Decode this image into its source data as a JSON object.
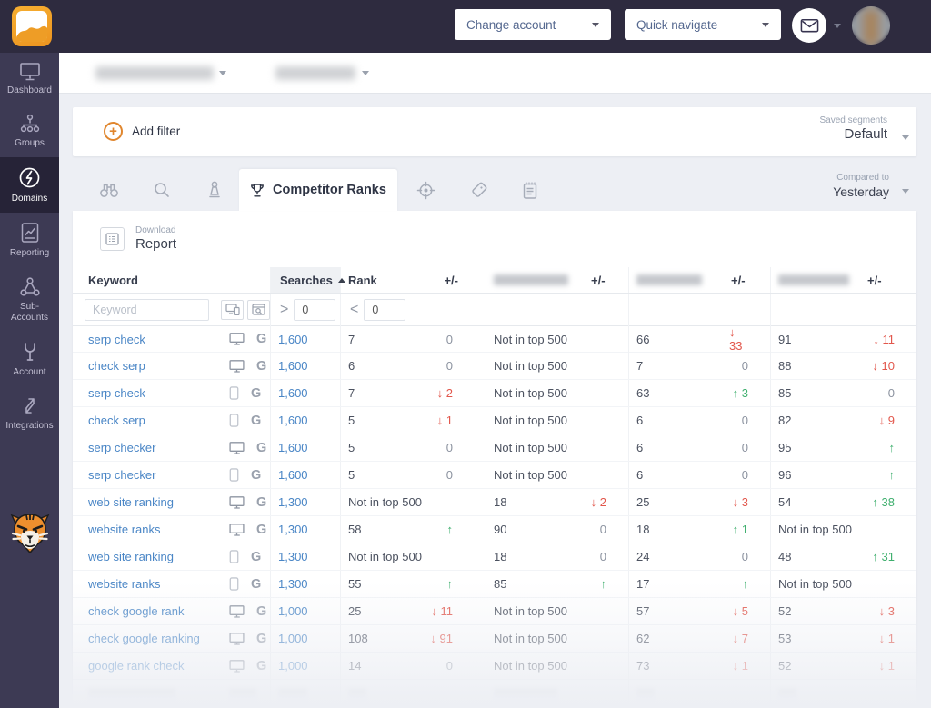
{
  "topbar": {
    "change_account": "Change account",
    "quick_navigate": "Quick navigate"
  },
  "sidebar": {
    "items": [
      {
        "label": "Dashboard",
        "icon": "dashboard-monitor-icon",
        "active": false
      },
      {
        "label": "Groups",
        "icon": "groups-hierarchy-icon",
        "active": false
      },
      {
        "label": "Domains",
        "icon": "domains-icon",
        "active": true
      },
      {
        "label": "Reporting",
        "icon": "reporting-chart-icon",
        "active": false
      },
      {
        "label": "Sub-Accounts",
        "icon": "sub-accounts-share-icon",
        "active": false
      },
      {
        "label": "Account",
        "icon": "account-wrench-icon",
        "active": false
      },
      {
        "label": "Integrations",
        "icon": "integrations-arrows-icon",
        "active": false
      }
    ]
  },
  "filter_bar": {
    "add_filter": "Add filter",
    "saved_segments_label": "Saved segments",
    "saved_segments_value": "Default"
  },
  "tab_bar": {
    "left_icons": [
      "binoculars-icon",
      "search-icon",
      "pawn-icon"
    ],
    "active_tab": "Competitor Ranks",
    "right_icons": [
      "target-icon",
      "tag-icon",
      "clipboard-icon"
    ],
    "compared_label": "Compared to",
    "compared_value": "Yesterday"
  },
  "report_button": {
    "line1": "Download",
    "line2": "Report"
  },
  "table": {
    "headers": {
      "keyword": "Keyword",
      "searches": "Searches",
      "rank": "Rank",
      "plus_minus": "+/-"
    },
    "filter_row": {
      "keyword_placeholder": "Keyword",
      "gt_symbol": ">",
      "gt_value": "0",
      "lt_symbol": "<",
      "lt_value": "0"
    },
    "rows": [
      {
        "keyword": "serp check",
        "device": "desktop",
        "engine": "G",
        "searches": "1,600",
        "rank": "7",
        "rank_d": {
          "dir": "zero",
          "value": "0"
        },
        "c1": "Not in top 500",
        "c1_d": null,
        "c2": "66",
        "c2_d": {
          "dir": "down",
          "value": "33"
        },
        "c3": "91",
        "c3_d": {
          "dir": "down",
          "value": "11"
        }
      },
      {
        "keyword": "check serp",
        "device": "desktop",
        "engine": "G",
        "searches": "1,600",
        "rank": "6",
        "rank_d": {
          "dir": "zero",
          "value": "0"
        },
        "c1": "Not in top 500",
        "c1_d": null,
        "c2": "7",
        "c2_d": {
          "dir": "zero",
          "value": "0"
        },
        "c3": "88",
        "c3_d": {
          "dir": "down",
          "value": "10"
        }
      },
      {
        "keyword": "serp check",
        "device": "mobile",
        "engine": "G",
        "searches": "1,600",
        "rank": "7",
        "rank_d": {
          "dir": "down",
          "value": "2"
        },
        "c1": "Not in top 500",
        "c1_d": null,
        "c2": "63",
        "c2_d": {
          "dir": "up",
          "value": "3"
        },
        "c3": "85",
        "c3_d": {
          "dir": "zero",
          "value": "0"
        }
      },
      {
        "keyword": "check serp",
        "device": "mobile",
        "engine": "G",
        "searches": "1,600",
        "rank": "5",
        "rank_d": {
          "dir": "down",
          "value": "1"
        },
        "c1": "Not in top 500",
        "c1_d": null,
        "c2": "6",
        "c2_d": {
          "dir": "zero",
          "value": "0"
        },
        "c3": "82",
        "c3_d": {
          "dir": "down",
          "value": "9"
        }
      },
      {
        "keyword": "serp checker",
        "device": "desktop",
        "engine": "G",
        "searches": "1,600",
        "rank": "5",
        "rank_d": {
          "dir": "zero",
          "value": "0"
        },
        "c1": "Not in top 500",
        "c1_d": null,
        "c2": "6",
        "c2_d": {
          "dir": "zero",
          "value": "0"
        },
        "c3": "95",
        "c3_d": {
          "dir": "up",
          "value": ""
        }
      },
      {
        "keyword": "serp checker",
        "device": "mobile",
        "engine": "G",
        "searches": "1,600",
        "rank": "5",
        "rank_d": {
          "dir": "zero",
          "value": "0"
        },
        "c1": "Not in top 500",
        "c1_d": null,
        "c2": "6",
        "c2_d": {
          "dir": "zero",
          "value": "0"
        },
        "c3": "96",
        "c3_d": {
          "dir": "up",
          "value": ""
        }
      },
      {
        "keyword": "web site ranking",
        "device": "desktop",
        "engine": "G",
        "searches": "1,300",
        "rank": "Not in top 500",
        "rank_d": null,
        "c1": "18",
        "c1_d": {
          "dir": "down",
          "value": "2"
        },
        "c2": "25",
        "c2_d": {
          "dir": "down",
          "value": "3"
        },
        "c3": "54",
        "c3_d": {
          "dir": "up",
          "value": "38"
        }
      },
      {
        "keyword": "website ranks",
        "device": "desktop",
        "engine": "G",
        "searches": "1,300",
        "rank": "58",
        "rank_d": {
          "dir": "up",
          "value": ""
        },
        "c1": "90",
        "c1_d": {
          "dir": "zero",
          "value": "0"
        },
        "c2": "18",
        "c2_d": {
          "dir": "up",
          "value": "1"
        },
        "c3": "Not in top 500",
        "c3_d": null
      },
      {
        "keyword": "web site ranking",
        "device": "mobile",
        "engine": "G",
        "searches": "1,300",
        "rank": "Not in top 500",
        "rank_d": null,
        "c1": "18",
        "c1_d": {
          "dir": "zero",
          "value": "0"
        },
        "c2": "24",
        "c2_d": {
          "dir": "zero",
          "value": "0"
        },
        "c3": "48",
        "c3_d": {
          "dir": "up",
          "value": "31"
        }
      },
      {
        "keyword": "website ranks",
        "device": "mobile",
        "engine": "G",
        "searches": "1,300",
        "rank": "55",
        "rank_d": {
          "dir": "up",
          "value": ""
        },
        "c1": "85",
        "c1_d": {
          "dir": "up",
          "value": ""
        },
        "c2": "17",
        "c2_d": {
          "dir": "up",
          "value": ""
        },
        "c3": "Not in top 500",
        "c3_d": null
      },
      {
        "keyword": "check google rank",
        "device": "desktop",
        "engine": "G",
        "searches": "1,000",
        "rank": "25",
        "rank_d": {
          "dir": "down",
          "value": "11"
        },
        "c1": "Not in top 500",
        "c1_d": null,
        "c2": "57",
        "c2_d": {
          "dir": "down",
          "value": "5"
        },
        "c3": "52",
        "c3_d": {
          "dir": "down",
          "value": "3"
        }
      },
      {
        "keyword": "check google ranking",
        "device": "desktop",
        "engine": "G",
        "searches": "1,000",
        "rank": "108",
        "rank_d": {
          "dir": "down",
          "value": "91"
        },
        "c1": "Not in top 500",
        "c1_d": null,
        "c2": "62",
        "c2_d": {
          "dir": "down",
          "value": "7"
        },
        "c3": "53",
        "c3_d": {
          "dir": "down",
          "value": "1"
        }
      },
      {
        "keyword": "google rank check",
        "device": "desktop",
        "engine": "G",
        "searches": "1,000",
        "rank": "14",
        "rank_d": {
          "dir": "zero",
          "value": "0"
        },
        "c1": "Not in top 500",
        "c1_d": null,
        "c2": "73",
        "c2_d": {
          "dir": "down",
          "value": "1"
        },
        "c3": "52",
        "c3_d": {
          "dir": "down",
          "value": "1"
        }
      },
      {
        "ghost": true
      }
    ]
  },
  "colors": {
    "accent_orange": "#e0862e",
    "link_blue": "#4a86c6",
    "negative_red": "#e2574c",
    "positive_green": "#3faf6e",
    "topbar_bg": "#2e2b3f",
    "sidebar_bg": "#3d3a54"
  }
}
